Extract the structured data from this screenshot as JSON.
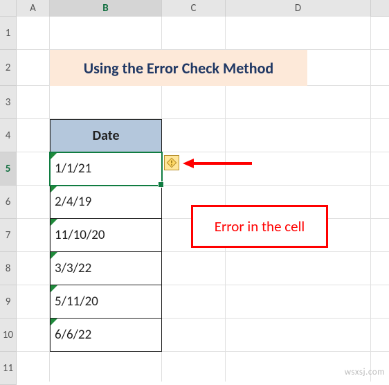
{
  "columns": [
    "A",
    "B",
    "C",
    "D"
  ],
  "rows": [
    "1",
    "2",
    "3",
    "4",
    "5",
    "6",
    "7",
    "8",
    "9",
    "10",
    "11"
  ],
  "selectedRow": "5",
  "selectedCol": "B",
  "title": "Using the Error Check Method",
  "table": {
    "header": "Date",
    "data": [
      "1/1/21",
      "2/4/19",
      "11/10/20",
      "3/3/22",
      "5/11/20",
      "6/6/22"
    ]
  },
  "callout": "Error in the cell",
  "watermark": "wsxsj.com"
}
